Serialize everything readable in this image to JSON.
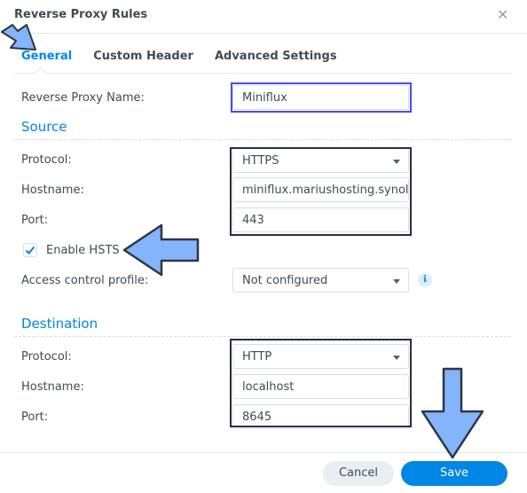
{
  "dialog": {
    "title": "Reverse Proxy Rules",
    "close_icon": "close-icon"
  },
  "tabs": [
    {
      "label": "General",
      "active": true
    },
    {
      "label": "Custom Header",
      "active": false
    },
    {
      "label": "Advanced Settings",
      "active": false
    }
  ],
  "general": {
    "name_label": "Reverse Proxy Name:",
    "name_value": "Miniflux",
    "source": {
      "heading": "Source",
      "protocol_label": "Protocol:",
      "protocol_value": "HTTPS",
      "hostname_label": "Hostname:",
      "hostname_value": "miniflux.mariushosting.synology.me",
      "port_label": "Port:",
      "port_value": "443",
      "hsts_label": "Enable HSTS",
      "hsts_checked": true,
      "access_label": "Access control profile:",
      "access_value": "Not configured",
      "info_icon": "i"
    },
    "destination": {
      "heading": "Destination",
      "protocol_label": "Protocol:",
      "protocol_value": "HTTP",
      "hostname_label": "Hostname:",
      "hostname_value": "localhost",
      "port_label": "Port:",
      "port_value": "8645"
    }
  },
  "footer": {
    "cancel_label": "Cancel",
    "save_label": "Save"
  },
  "colors": {
    "accent": "#0086e5",
    "annotation_arrow": "#84b4fc"
  }
}
